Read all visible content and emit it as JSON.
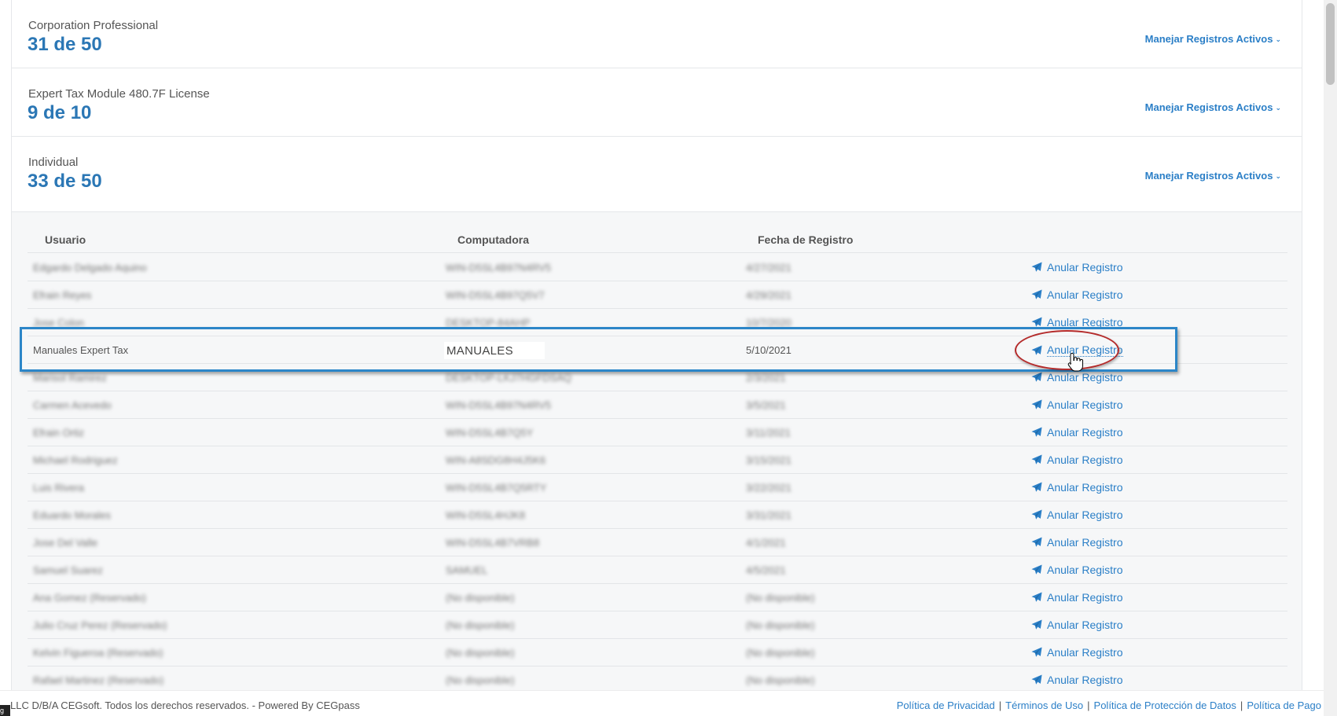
{
  "licenses": [
    {
      "name": "Corporation Professional",
      "count": "31 de 50",
      "manage": "Manejar Registros Activos"
    },
    {
      "name": "Expert Tax Module 480.7F License",
      "count": "9 de 10",
      "manage": "Manejar Registros Activos"
    },
    {
      "name": "Individual",
      "count": "33 de 50",
      "manage": "Manejar Registros Activos"
    }
  ],
  "table": {
    "headers": {
      "user": "Usuario",
      "computer": "Computadora",
      "date": "Fecha de Registro"
    },
    "action_label": "Anular Registro",
    "highlighted_row": {
      "user": "Manuales Expert Tax",
      "computer": "MANUALES",
      "date": "5/10/2021"
    }
  },
  "footer": {
    "badge": "g",
    "copyright": "LLC D/B/A CEGsoft. Todos los derechos reservados. - Powered By CEGpass",
    "links": [
      "Política de Privacidad",
      "Términos de Uso",
      "Política de Protección de Datos",
      "Política de Pago"
    ],
    "separator": "|"
  },
  "colors": {
    "accent": "#2b7fc7",
    "count": "#2b77b5",
    "highlight_box": "#2c86c8",
    "highlight_circle": "#b42a2a"
  }
}
